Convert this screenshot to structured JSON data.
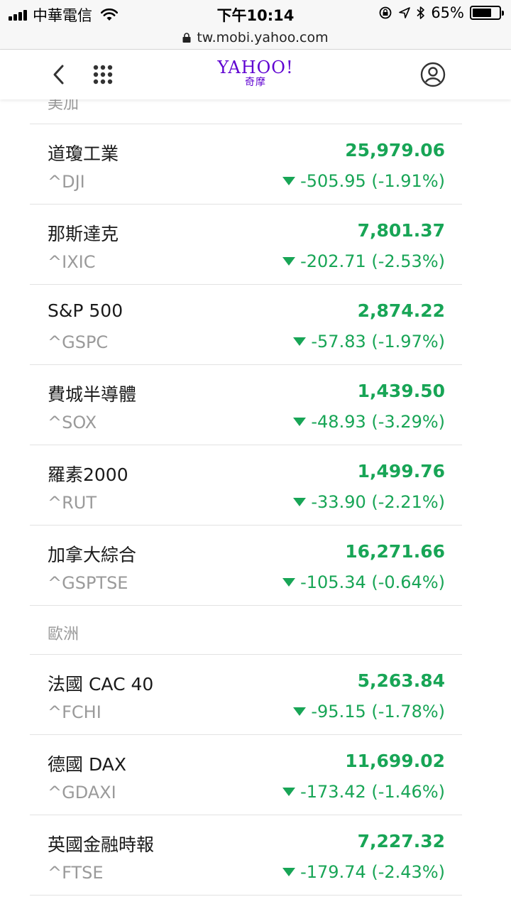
{
  "status_bar": {
    "carrier": "中華電信",
    "time": "下午10:14",
    "battery": "65%",
    "battery_level": 0.65
  },
  "url_bar": {
    "url": "tw.mobi.yahoo.com"
  },
  "header": {
    "logo_text": "YAHOO!",
    "logo_sub": "奇摩",
    "brand_color": "#5f01d1"
  },
  "sections": [
    {
      "title": "美加",
      "items": [
        {
          "name": "道瓊工業",
          "symbol": "^DJI",
          "price": "25,979.06",
          "change": "-505.95 (-1.91%)"
        },
        {
          "name": "那斯達克",
          "symbol": "^IXIC",
          "price": "7,801.37",
          "change": "-202.71 (-2.53%)"
        },
        {
          "name": "S&P 500",
          "symbol": "^GSPC",
          "price": "2,874.22",
          "change": "-57.83 (-1.97%)"
        },
        {
          "name": "費城半導體",
          "symbol": "^SOX",
          "price": "1,439.50",
          "change": "-48.93 (-3.29%)"
        },
        {
          "name": "羅素2000",
          "symbol": "^RUT",
          "price": "1,499.76",
          "change": "-33.90 (-2.21%)"
        },
        {
          "name": "加拿大綜合",
          "symbol": "^GSPTSE",
          "price": "16,271.66",
          "change": "-105.34 (-0.64%)"
        }
      ]
    },
    {
      "title": "歐洲",
      "items": [
        {
          "name": "法國 CAC 40",
          "symbol": "^FCHI",
          "price": "5,263.84",
          "change": "-95.15 (-1.78%)"
        },
        {
          "name": "德國 DAX",
          "symbol": "^GDAXI",
          "price": "11,699.02",
          "change": "-173.42 (-1.46%)"
        },
        {
          "name": "英國金融時報",
          "symbol": "^FTSE",
          "price": "7,227.32",
          "change": "-179.74 (-2.43%)"
        }
      ]
    }
  ],
  "colors": {
    "positive_text": "#18a556",
    "muted_text": "#9a9a9a",
    "divider": "#e2e2e2"
  },
  "icons": {
    "back": "chevron-left-icon",
    "menu": "grid-dots-icon",
    "account": "user-circle-icon",
    "down": "triangle-down-icon"
  }
}
